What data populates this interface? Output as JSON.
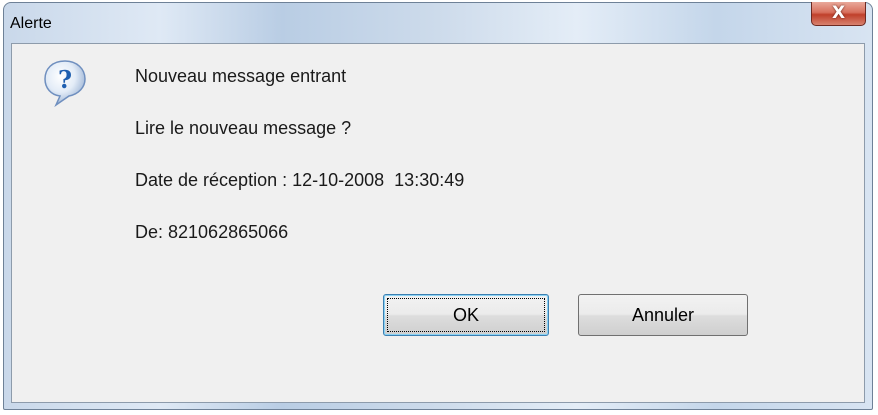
{
  "window": {
    "title": "Alerte",
    "close_glyph": "X"
  },
  "dialog": {
    "icon": "question-icon",
    "lines": [
      "Nouveau message entrant",
      "Lire le nouveau message ?",
      "Date de réception : 12-10-2008  13:30:49",
      "De: 821062865066"
    ]
  },
  "buttons": {
    "ok_label": "OK",
    "cancel_label": "Annuler"
  },
  "colors": {
    "close_button": "#c0402b",
    "dialog_background": "#f0f0f0",
    "icon_blue": "#1f5fb0"
  }
}
